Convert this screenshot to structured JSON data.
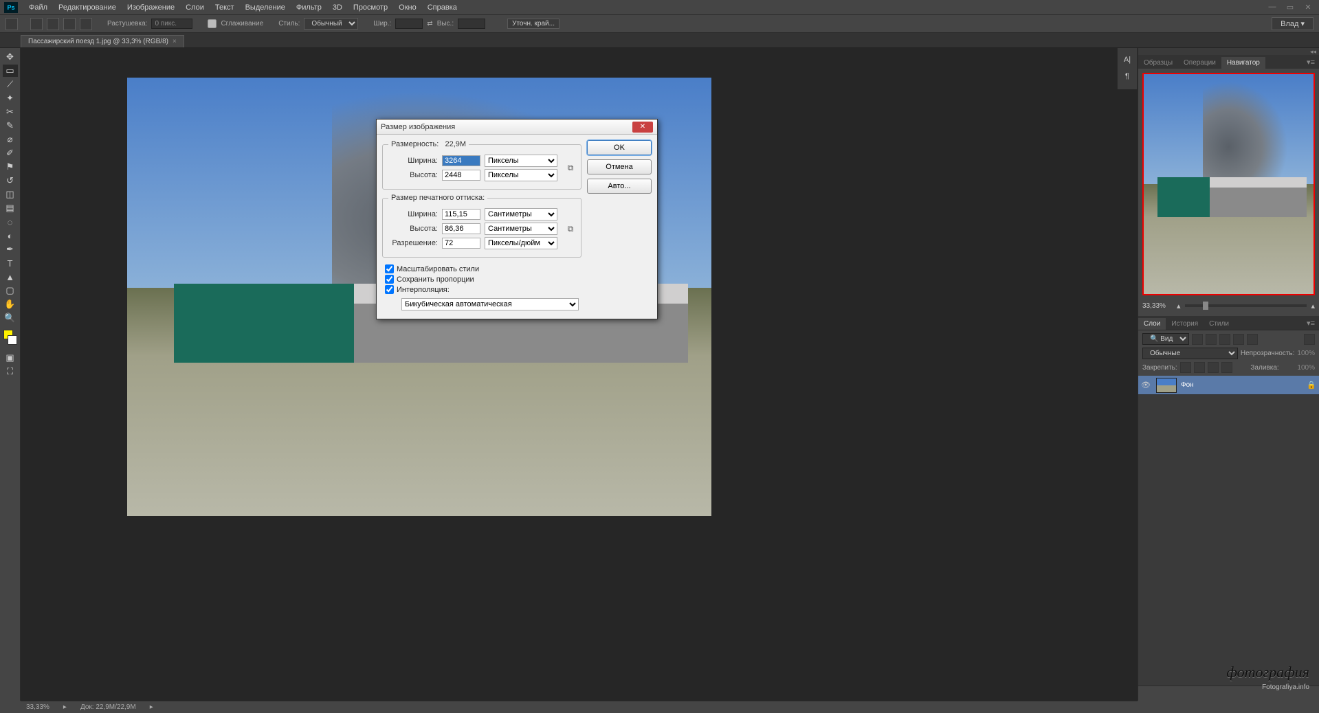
{
  "app": {
    "logo": "Ps"
  },
  "menu": {
    "items": [
      "Файл",
      "Редактирование",
      "Изображение",
      "Слои",
      "Текст",
      "Выделение",
      "Фильтр",
      "3D",
      "Просмотр",
      "Окно",
      "Справка"
    ]
  },
  "options": {
    "feather_label": "Растушевка:",
    "feather_value": "0 пикс.",
    "antialias": "Сглаживание",
    "style_label": "Стиль:",
    "style_value": "Обычный",
    "width_label": "Шир.:",
    "height_label": "Выс.:",
    "refine_label": "Уточн. край...",
    "workspace": "Влад"
  },
  "doc": {
    "tab_title": "Пассажирский поезд 1.jpg @ 33,3% (RGB/8)"
  },
  "status": {
    "zoom": "33,33%",
    "doc_info": "Док: 22,9M/22,9M"
  },
  "panels": {
    "group1": [
      "Образцы",
      "Операции",
      "Навигатор"
    ],
    "navigator_zoom": "33,33%",
    "group2": [
      "Слои",
      "История",
      "Стили"
    ],
    "layer_kind": "Вид",
    "blend_mode": "Обычные",
    "opacity_label": "Непрозрачность:",
    "opacity_value": "100%",
    "lock_label": "Закрепить:",
    "fill_label": "Заливка:",
    "fill_value": "100%",
    "layer_name": "Фон"
  },
  "dialog": {
    "title": "Размер изображения",
    "dims_legend": "Размерность:",
    "dims_value": "22,9M",
    "width_label": "Ширина:",
    "height_label": "Высота:",
    "pixel_w": "3264",
    "pixel_h": "2448",
    "unit_px": "Пикселы",
    "print_legend": "Размер печатного оттиска:",
    "print_w": "115,15",
    "print_h": "86,36",
    "unit_cm": "Сантиметры",
    "resolution_label": "Разрешение:",
    "resolution_value": "72",
    "unit_dpi": "Пикселы/дюйм",
    "scale_styles": "Масштабировать стили",
    "constrain": "Сохранить пропорции",
    "resample": "Интерполяция:",
    "interp_method": "Бикубическая автоматическая",
    "ok": "OK",
    "cancel": "Отмена",
    "auto": "Авто..."
  },
  "watermark": {
    "text": "фотография",
    "url": "Fotografiya.info"
  }
}
